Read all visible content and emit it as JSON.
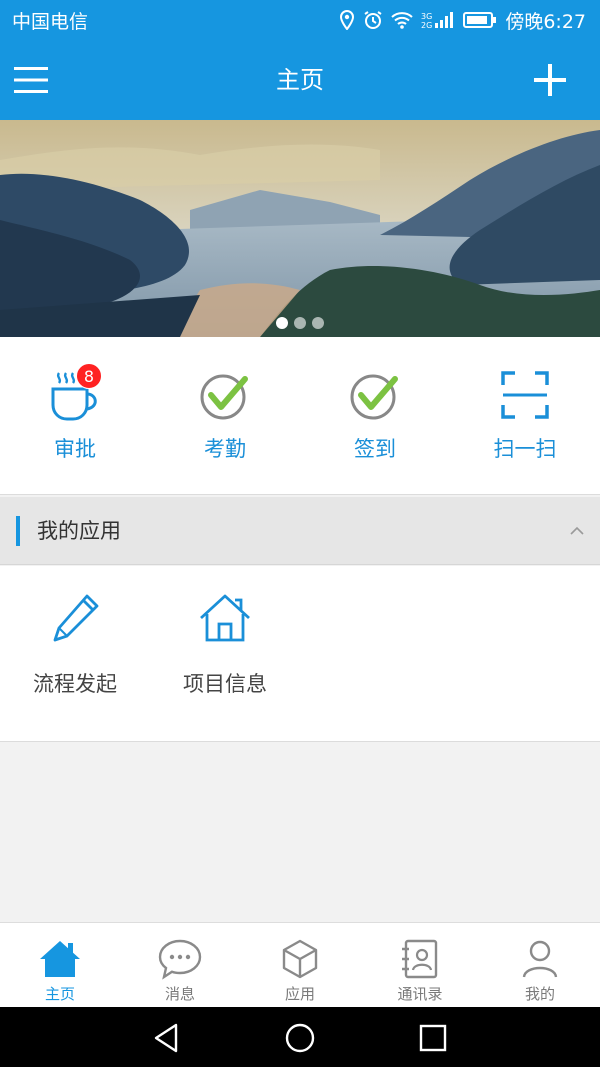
{
  "status_bar": {
    "carrier": "中国电信",
    "time": "傍晚6:27",
    "icons": [
      "location-icon",
      "alarm-icon",
      "wifi-icon",
      "signal-icon",
      "battery-icon"
    ]
  },
  "header": {
    "title": "主页",
    "left_icon": "menu-icon",
    "right_icon": "plus-icon"
  },
  "banner": {
    "slide_count": 3,
    "active_index": 0
  },
  "quick_actions": [
    {
      "label": "审批",
      "icon": "coffee-cup-icon",
      "badge": "8"
    },
    {
      "label": "考勤",
      "icon": "check-circle-icon"
    },
    {
      "label": "签到",
      "icon": "check-circle-icon"
    },
    {
      "label": "扫一扫",
      "icon": "scan-icon"
    }
  ],
  "my_apps": {
    "title": "我的应用",
    "toggle_icon": "chevron-up-icon",
    "items": [
      {
        "label": "流程发起",
        "icon": "pen-icon"
      },
      {
        "label": "项目信息",
        "icon": "house-icon"
      }
    ]
  },
  "bottom_nav": [
    {
      "label": "主页",
      "icon": "home-icon",
      "active": true
    },
    {
      "label": "消息",
      "icon": "chat-bubble-icon",
      "active": false
    },
    {
      "label": "应用",
      "icon": "cube-icon",
      "active": false
    },
    {
      "label": "通讯录",
      "icon": "contacts-book-icon",
      "active": false
    },
    {
      "label": "我的",
      "icon": "person-icon",
      "active": false
    }
  ],
  "system_nav": [
    "back-icon",
    "home-circle-icon",
    "recents-icon"
  ],
  "colors": {
    "primary": "#1696e0",
    "check_green": "#7cc242",
    "badge_red": "#ff2222",
    "inactive_gray": "#7a7a7a"
  }
}
